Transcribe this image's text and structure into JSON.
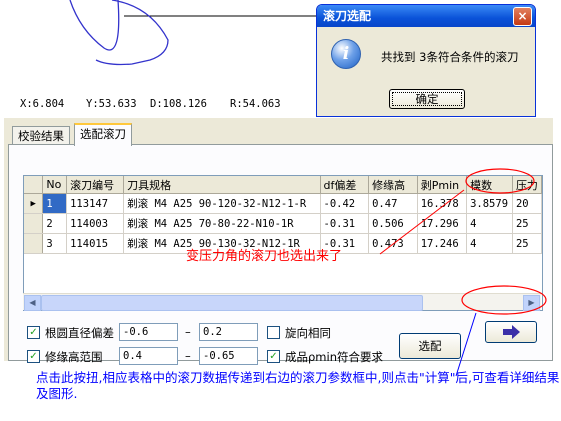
{
  "preview": {
    "coords": {
      "x": "X:6.804",
      "y": "Y:53.633",
      "d": "D:108.126",
      "r": "R:54.063"
    }
  },
  "dialog": {
    "title": "滚刀选配",
    "message": "共找到 3条符合条件的滚刀",
    "ok_label": "确定",
    "close_label": "×",
    "icon": "info-icon"
  },
  "tabs": [
    {
      "label": "校验结果",
      "active": false
    },
    {
      "label": "选配滚刀",
      "active": true
    }
  ],
  "grid": {
    "columns": [
      "No",
      "滚刀编号",
      "刀具规格",
      "df偏差",
      "修缘高",
      "剥Pmin",
      "模数",
      "压力"
    ],
    "rows": [
      {
        "no": "1",
        "code": "113147",
        "spec": "剃滚 M4 A25 90-120-32-N12-1-R",
        "df_dev": "-0.42",
        "tip_relief": "0.47",
        "pmin": "16.378",
        "module": "3.8579",
        "pressure": "20",
        "current": true
      },
      {
        "no": "2",
        "code": "114003",
        "spec": "剃滚 M4 A25 70-80-22-N10-1R",
        "df_dev": "-0.31",
        "tip_relief": "0.506",
        "pmin": "17.296",
        "module": "4",
        "pressure": "25",
        "current": false
      },
      {
        "no": "3",
        "code": "114015",
        "spec": "剃滚 M4 A25 90-130-32-N12-1R",
        "df_dev": "-0.31",
        "tip_relief": "0.473",
        "pmin": "17.246",
        "module": "4",
        "pressure": "25",
        "current": false
      }
    ]
  },
  "options": {
    "root_dia_dev": {
      "label": "根圆直径偏差",
      "checked": true,
      "min": "-0.6",
      "max": "0.2",
      "sep": "–"
    },
    "tip_relief_range": {
      "label": "修缘高范围",
      "checked": true,
      "min": "0.4",
      "max": "-0.65",
      "sep": "–"
    },
    "same_hand": {
      "label": "旋向相同",
      "checked": false
    },
    "rho_min": {
      "label": "成品ρmin符合要求",
      "checked": true
    },
    "select_button": "选配",
    "transfer_button_icon": "arrow-right-icon"
  },
  "annotations": {
    "red": "变压力角的滚刀也选出来了",
    "blue": "点击此按扭,相应表格中的滚刀数据传递到右边的滚刀参数框中,则点击\"计算\"后,可查看详细结果及图形."
  },
  "colors": {
    "annotation_red": "#ff0000",
    "annotation_blue": "#0000ff",
    "curve_blue": "#3333cc",
    "highlight_circle": "#ff0000"
  }
}
